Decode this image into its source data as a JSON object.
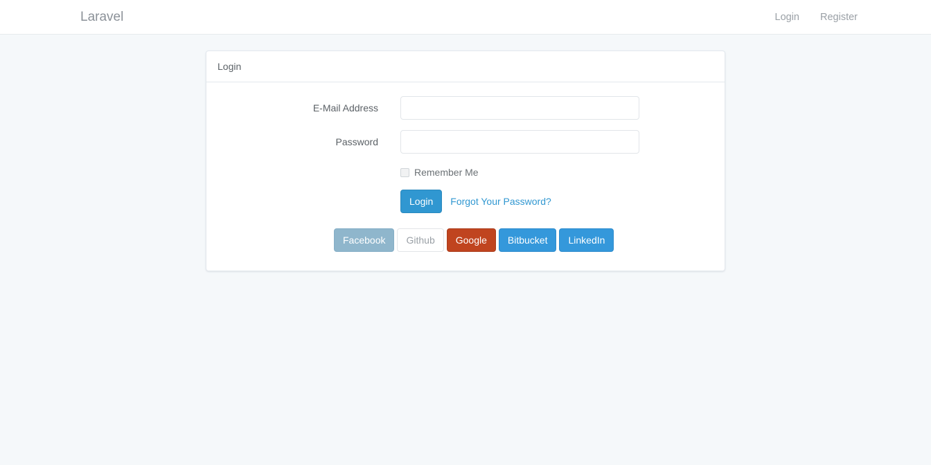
{
  "navbar": {
    "brand": "Laravel",
    "links": [
      {
        "label": "Login"
      },
      {
        "label": "Register"
      }
    ]
  },
  "card": {
    "header_title": "Login",
    "form": {
      "email": {
        "label": "E-Mail Address",
        "value": "",
        "placeholder": ""
      },
      "password": {
        "label": "Password",
        "value": "",
        "placeholder": ""
      },
      "remember": {
        "label": "Remember Me",
        "checked": false
      },
      "submit_label": "Login",
      "forgot_label": "Forgot Your Password?"
    },
    "social_buttons": [
      {
        "label": "Facebook",
        "color": "#8fb6cc"
      },
      {
        "label": "Github",
        "color": "#ffffff"
      },
      {
        "label": "Google",
        "color": "#c0441f"
      },
      {
        "label": "Bitbucket",
        "color": "#3498db"
      },
      {
        "label": "LinkedIn",
        "color": "#3498db"
      }
    ]
  },
  "theme": {
    "page_background": "#f5f8fa",
    "accent": "#3097d1",
    "text": "#636b6f",
    "card_background": "#ffffff",
    "border": "#e3e8ee"
  }
}
